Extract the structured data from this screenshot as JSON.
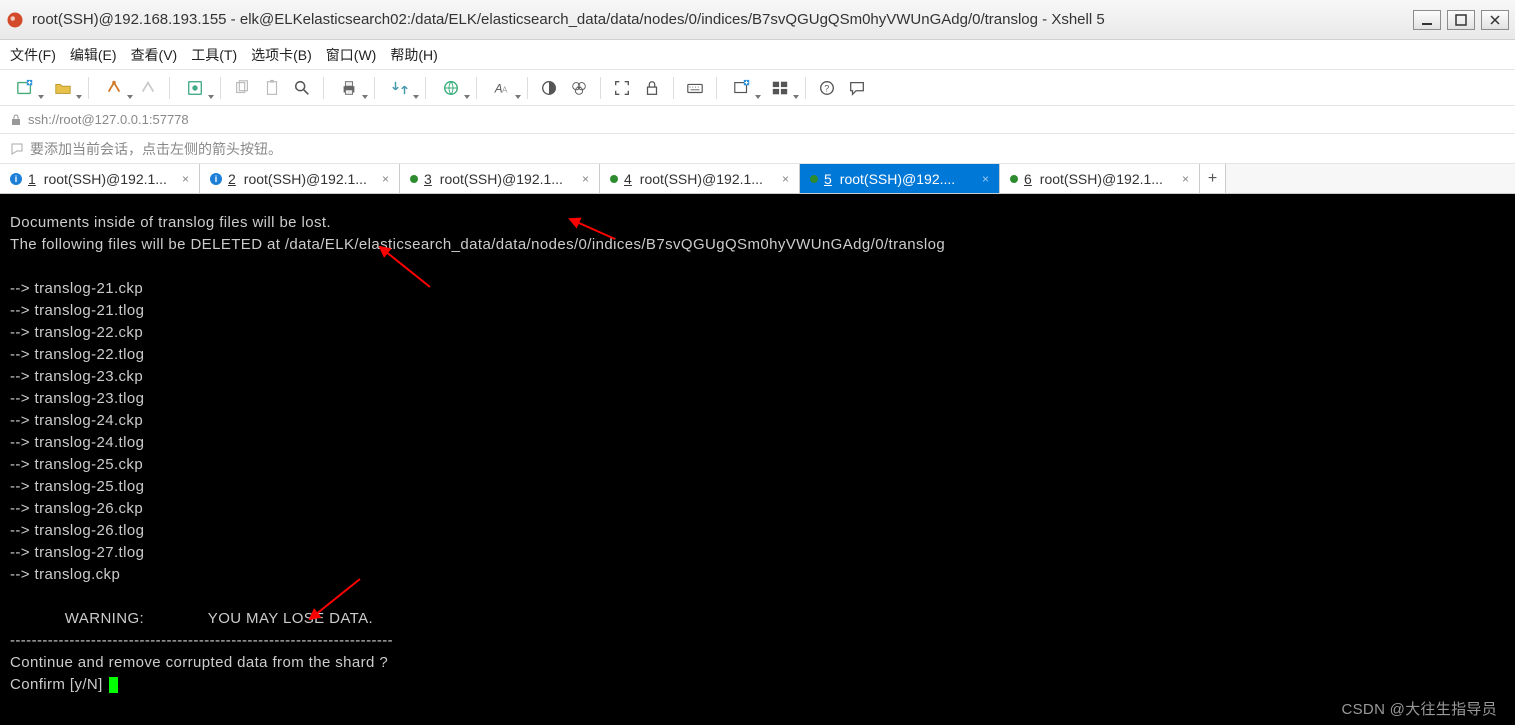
{
  "window": {
    "title": "root(SSH)@192.168.193.155 - elk@ELKelasticsearch02:/data/ELK/elasticsearch_data/data/nodes/0/indices/B7svQGUgQSm0hyVWUnGAdg/0/translog - Xshell 5"
  },
  "menu": {
    "file": "文件(F)",
    "edit": "编辑(E)",
    "view": "查看(V)",
    "tools": "工具(T)",
    "options": "选项卡(B)",
    "window": "窗口(W)",
    "help": "帮助(H)"
  },
  "address": {
    "text": "ssh://root@127.0.0.1:57778"
  },
  "hint": {
    "text": "要添加当前会话，点击左侧的箭头按钮。"
  },
  "tabs": [
    {
      "num": "1",
      "label": "root(SSH)@192.1...",
      "active": false,
      "icon": "info"
    },
    {
      "num": "2",
      "label": "root(SSH)@192.1...",
      "active": false,
      "icon": "info"
    },
    {
      "num": "3",
      "label": "root(SSH)@192.1...",
      "active": false,
      "icon": "dot"
    },
    {
      "num": "4",
      "label": "root(SSH)@192.1...",
      "active": false,
      "icon": "dot"
    },
    {
      "num": "5",
      "label": "root(SSH)@192....",
      "active": true,
      "icon": "dot"
    },
    {
      "num": "6",
      "label": "root(SSH)@192.1...",
      "active": false,
      "icon": "dot"
    }
  ],
  "terminal": {
    "l1": "Documents inside of translog files will be lost.",
    "l2": "The following files will be DELETED at /data/ELK/elasticsearch_data/data/nodes/0/indices/B7svQGUgQSm0hyVWUnGAdg/0/translog",
    "l3": "",
    "l4": "--> translog-21.ckp",
    "l5": "--> translog-21.tlog",
    "l6": "--> translog-22.ckp",
    "l7": "--> translog-22.tlog",
    "l8": "--> translog-23.ckp",
    "l9": "--> translog-23.tlog",
    "l10": "--> translog-24.ckp",
    "l11": "--> translog-24.tlog",
    "l12": "--> translog-25.ckp",
    "l13": "--> translog-25.tlog",
    "l14": "--> translog-26.ckp",
    "l15": "--> translog-26.tlog",
    "l16": "--> translog-27.tlog",
    "l17": "--> translog.ckp",
    "l18": "",
    "l19": "            WARNING:              YOU MAY LOSE DATA.",
    "l20": "-----------------------------------------------------------------------",
    "l21": "Continue and remove corrupted data from the shard ?",
    "l22": "Confirm [y/N] "
  },
  "watermark": "CSDN @大往生指导员"
}
